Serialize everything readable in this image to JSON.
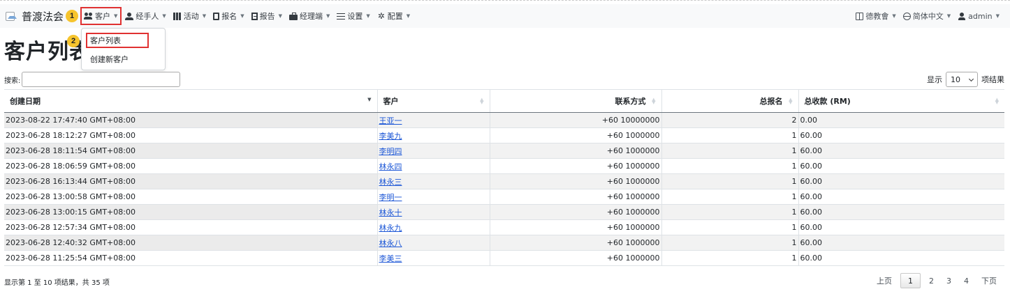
{
  "navbar": {
    "brand": "普渡法会",
    "step1": "1",
    "step2": "2",
    "items": [
      {
        "label": "客户",
        "icon": "users-icon"
      },
      {
        "label": "经手人",
        "icon": "agent-icon"
      },
      {
        "label": "活动",
        "icon": "map-icon"
      },
      {
        "label": "报名",
        "icon": "form-icon"
      },
      {
        "label": "报告",
        "icon": "report-icon"
      },
      {
        "label": "经理端",
        "icon": "briefcase-icon"
      },
      {
        "label": "设置",
        "icon": "sliders-icon"
      },
      {
        "label": "配置",
        "icon": "gear-icon"
      }
    ],
    "right": [
      {
        "label": "德教會",
        "icon": "book-icon"
      },
      {
        "label": "简体中文",
        "icon": "globe-icon"
      },
      {
        "label": "admin",
        "icon": "user-icon"
      }
    ]
  },
  "dropdown": {
    "items": [
      "客户列表",
      "创建新客户"
    ]
  },
  "page": {
    "title": "客户列表"
  },
  "search": {
    "label": "搜索:",
    "value": ""
  },
  "length": {
    "prefix": "显示",
    "value": "10",
    "suffix": "项结果"
  },
  "table": {
    "headers": [
      "创建日期",
      "客户",
      "联系方式",
      "总报名",
      "总收款 (RM)"
    ],
    "rows": [
      [
        "2023-08-22 17:47:40 GMT+08:00",
        "王亚一",
        "+60 10000000",
        "2",
        "0.00"
      ],
      [
        "2023-06-28 18:12:27 GMT+08:00",
        "李美九",
        "+60 1000000",
        "1",
        "60.00"
      ],
      [
        "2023-06-28 18:11:54 GMT+08:00",
        "李明四",
        "+60 1000000",
        "1",
        "60.00"
      ],
      [
        "2023-06-28 18:06:59 GMT+08:00",
        "林永四",
        "+60 1000000",
        "1",
        "60.00"
      ],
      [
        "2023-06-28 16:13:44 GMT+08:00",
        "林永三",
        "+60 1000000",
        "1",
        "60.00"
      ],
      [
        "2023-06-28 13:00:58 GMT+08:00",
        "李明一",
        "+60 1000000",
        "1",
        "60.00"
      ],
      [
        "2023-06-28 13:00:15 GMT+08:00",
        "林永十",
        "+60 1000000",
        "1",
        "60.00"
      ],
      [
        "2023-06-28 12:57:34 GMT+08:00",
        "林永九",
        "+60 1000000",
        "1",
        "60.00"
      ],
      [
        "2023-06-28 12:40:32 GMT+08:00",
        "林永八",
        "+60 1000000",
        "1",
        "60.00"
      ],
      [
        "2023-06-28 11:25:54 GMT+08:00",
        "李美三",
        "+60 1000000",
        "1",
        "60.00"
      ]
    ]
  },
  "footer": {
    "info": "显示第 1 至 10 项结果，共 35 项",
    "prev": "上页",
    "pages": [
      "1",
      "2",
      "3",
      "4"
    ],
    "current_page": "1",
    "next": "下页"
  },
  "colors": {
    "highlight": "#e03131",
    "badge": "#f6c42d",
    "link": "#1a55d6"
  }
}
